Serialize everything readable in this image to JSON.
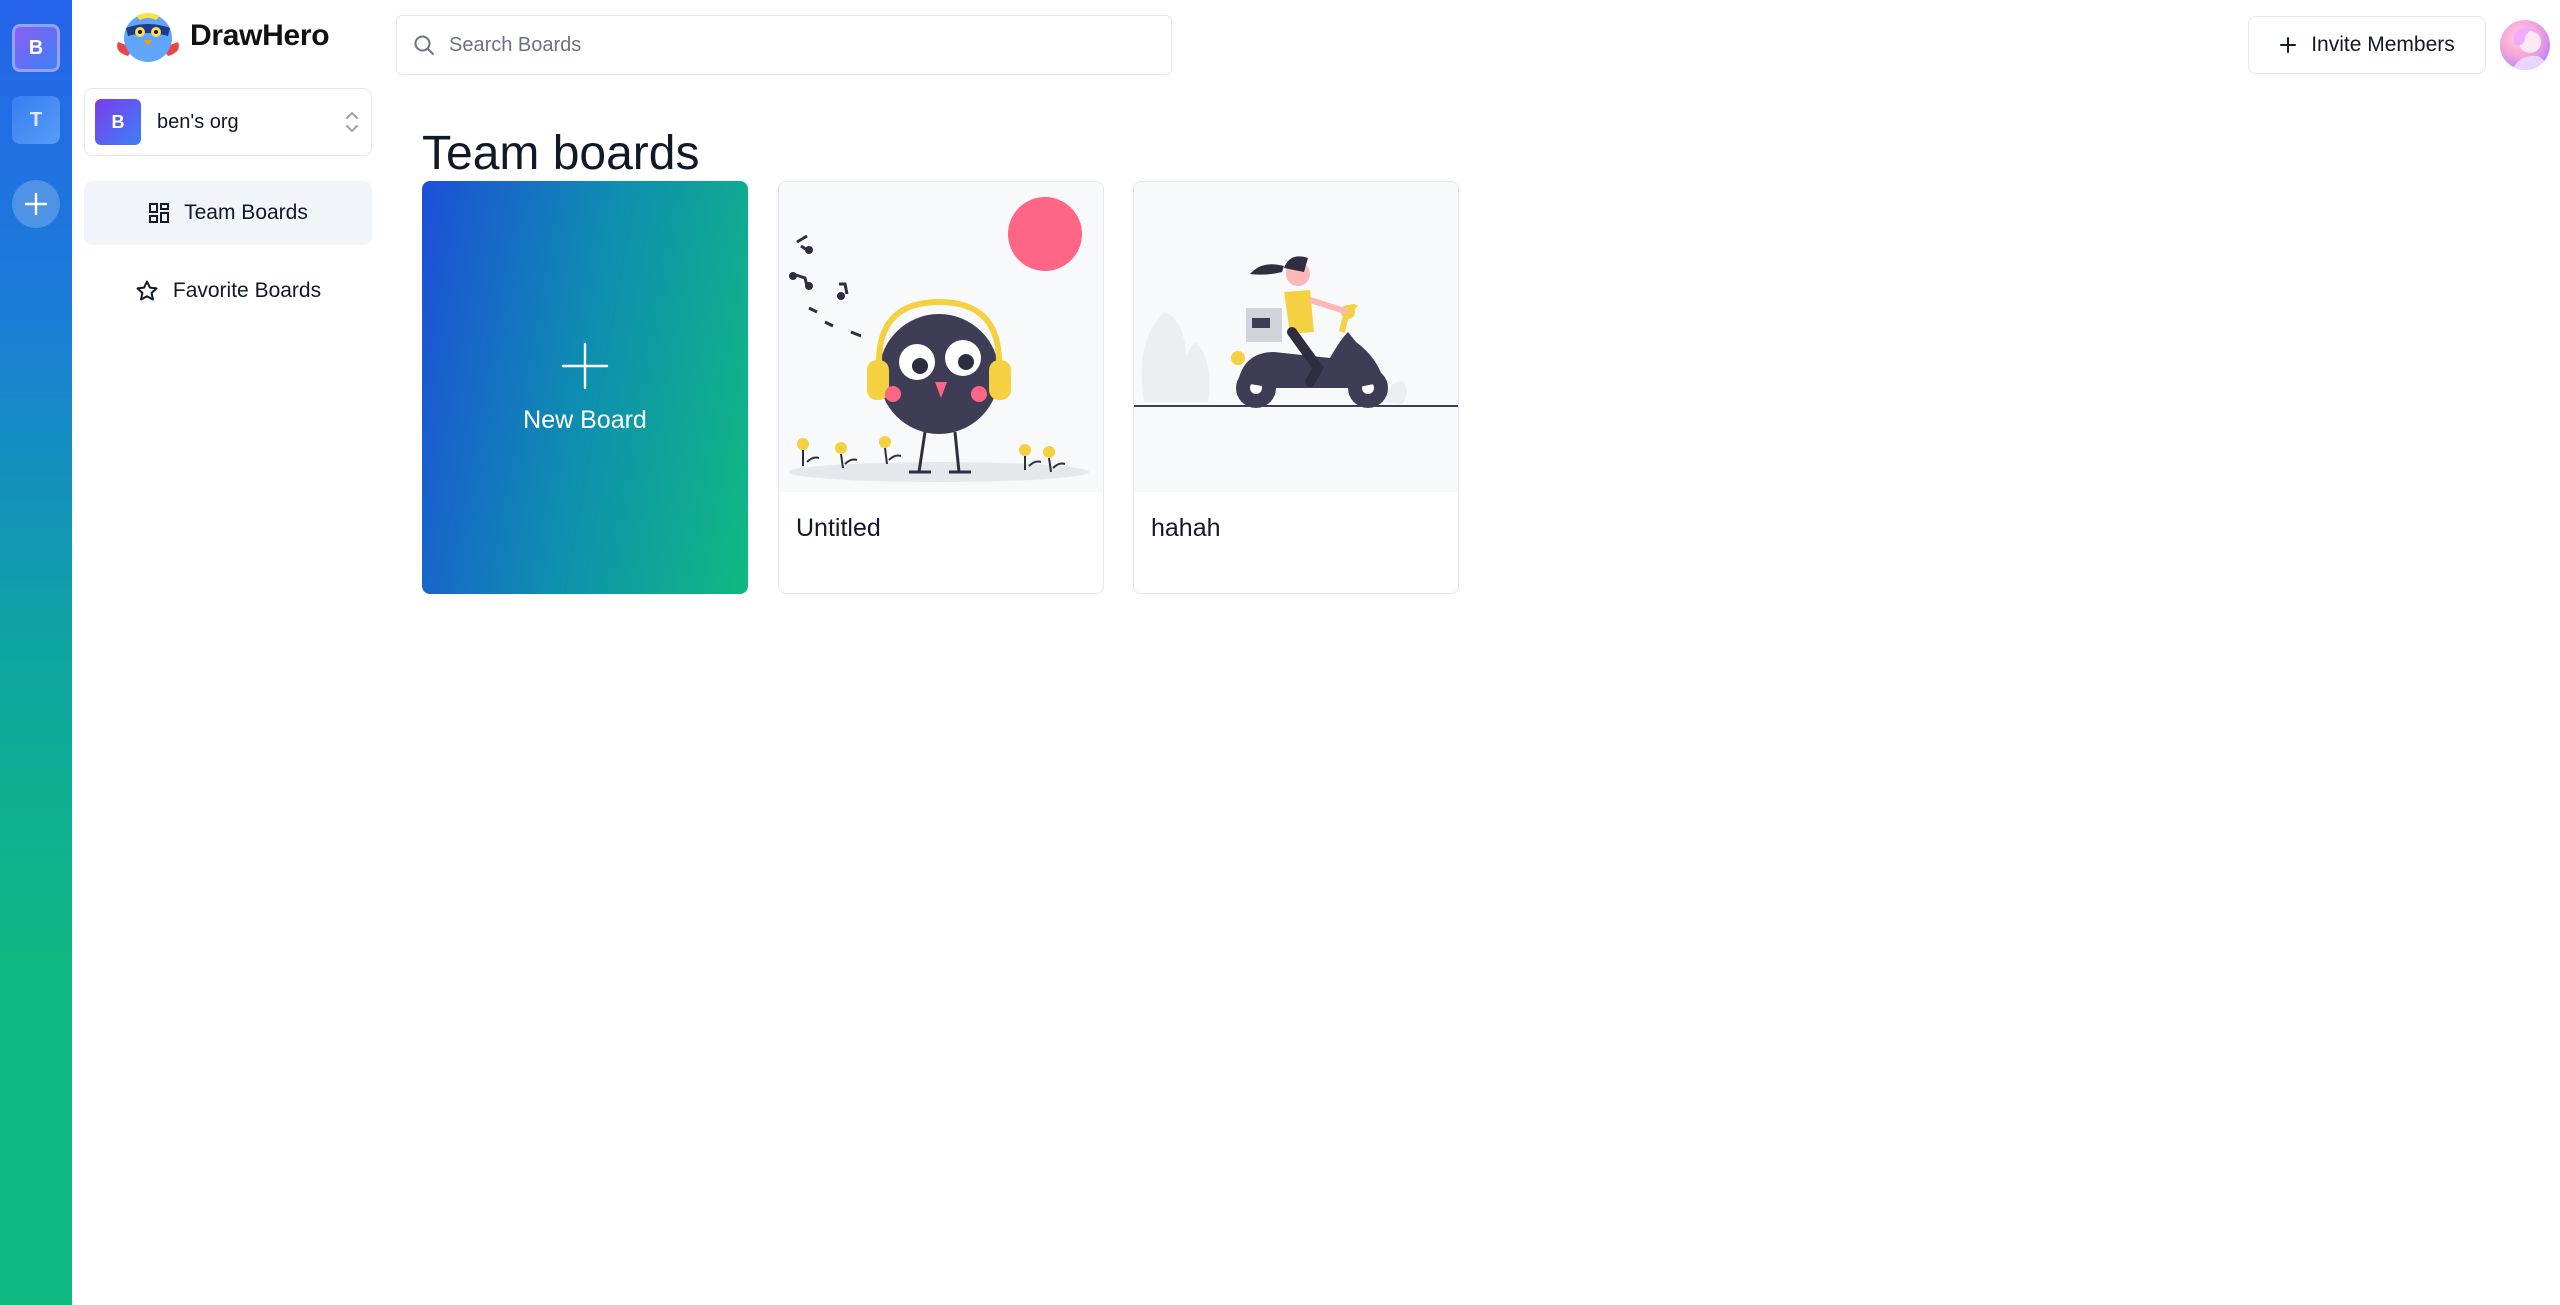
{
  "app": {
    "name": "DrawHero"
  },
  "rail": {
    "orgs": [
      {
        "initial": "B"
      },
      {
        "initial": "T"
      }
    ]
  },
  "sidebar": {
    "org": {
      "initial": "B",
      "name": "ben's org"
    },
    "nav": [
      {
        "label": "Team Boards",
        "active": true,
        "icon": "dashboard-icon"
      },
      {
        "label": "Favorite Boards",
        "active": false,
        "icon": "star-icon"
      }
    ]
  },
  "header": {
    "search_placeholder": "Search Boards",
    "invite_label": "Invite Members"
  },
  "main": {
    "title": "Team boards",
    "new_board_label": "New Board",
    "boards": [
      {
        "title": "Untitled",
        "thumbnail": "bird-headphones-illustration"
      },
      {
        "title": "hahah",
        "thumbnail": "scooter-delivery-illustration"
      }
    ]
  },
  "colors": {
    "rail_top": "#2563eb",
    "rail_bottom": "#10b981",
    "new_board_start": "#1d4ed8",
    "new_board_end": "#10b981",
    "nav_active_bg": "#f1f5f9"
  }
}
